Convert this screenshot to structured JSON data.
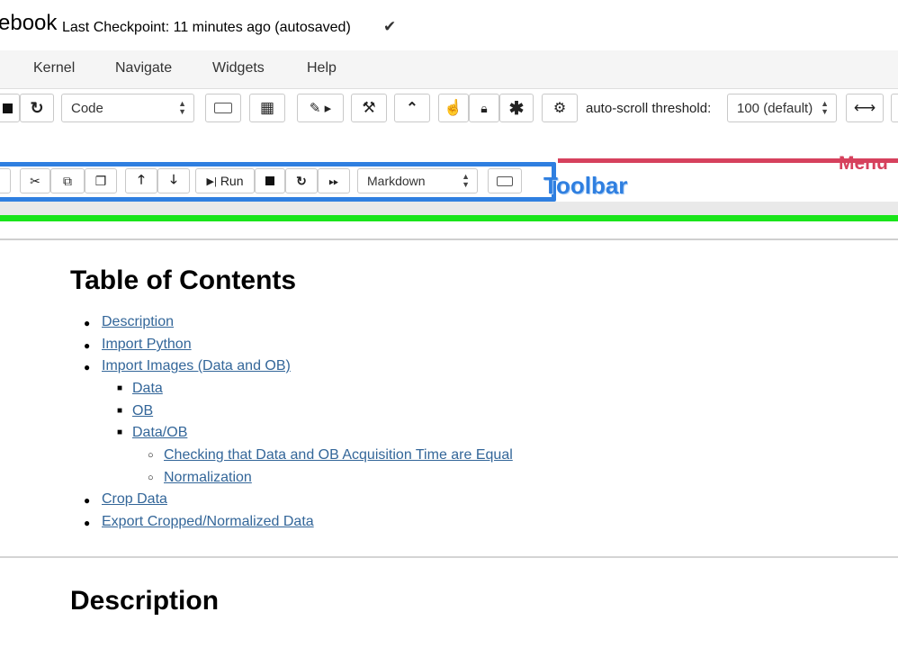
{
  "header": {
    "notebook_name": "ebook",
    "checkpoint": "Last Checkpoint: 11 minutes ago (autosaved)",
    "checkpoint_icon": "check-icon"
  },
  "menubar": {
    "items": [
      "Kernel",
      "Navigate",
      "Widgets",
      "Help"
    ]
  },
  "toolbar1": {
    "cell_type": "Code",
    "autoscroll_label": "auto-scroll threshold:",
    "autoscroll_value": "100 (default)"
  },
  "toolbar2": {
    "run_label": "Run",
    "cell_type": "Markdown"
  },
  "annotations": {
    "toolbar": "Toolbar",
    "menu": "Menu",
    "colors": {
      "menu": "#d6415d",
      "toolbar": "#2f7fe0",
      "notebook": "#19e51a"
    }
  },
  "toc": {
    "title": "Table of Contents",
    "items": [
      "Description",
      "Import Python",
      "Import Images (Data and OB)",
      "Data",
      "OB",
      "Data/OB",
      "Checking that Data and OB Acquisition Time are Equal",
      "Normalization",
      "Crop Data",
      "Export Cropped/Normalized Data"
    ]
  },
  "description": {
    "title": "Description"
  }
}
